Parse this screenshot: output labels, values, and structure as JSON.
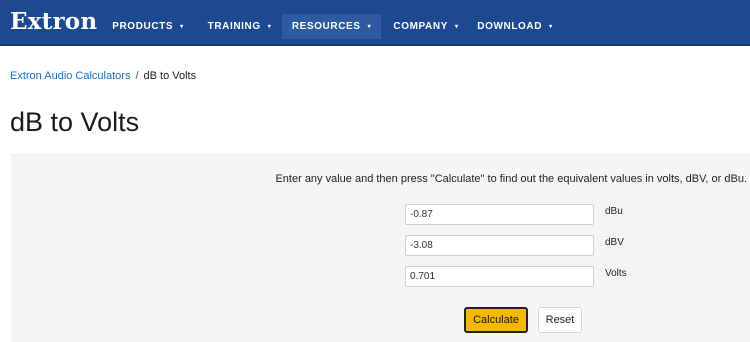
{
  "header": {
    "logo": "Extron",
    "nav": [
      {
        "label": "PRODUCTS",
        "caret": "▾",
        "active": false
      },
      {
        "label": "TRAINING",
        "caret": "▾",
        "active": false
      },
      {
        "label": "RESOURCES",
        "caret": "▾",
        "active": true
      },
      {
        "label": "COMPANY",
        "caret": "▾",
        "active": false
      },
      {
        "label": "DOWNLOAD",
        "caret": "▾",
        "active": false
      }
    ]
  },
  "breadcrumb": {
    "parent": "Extron Audio Calculators",
    "separator": "/",
    "current": "dB to Volts"
  },
  "page": {
    "title": "dB to Volts"
  },
  "calculator": {
    "instructions": "Enter any value and then press \"Calculate\" to find out the equivalent values in volts, dBV, or dBu.",
    "fields": [
      {
        "value": "-0.87",
        "unit": "dBu"
      },
      {
        "value": "-3.08",
        "unit": "dBV"
      },
      {
        "value": "0.701",
        "unit": "Volts"
      }
    ],
    "calculate_label": "Calculate",
    "reset_label": "Reset"
  },
  "colors": {
    "navbar": "#1d4990",
    "nav_active": "#2d5aa1",
    "link": "#1a6fc4",
    "calculate_button": "#f5b800",
    "panel_background": "#f5f5f5"
  }
}
